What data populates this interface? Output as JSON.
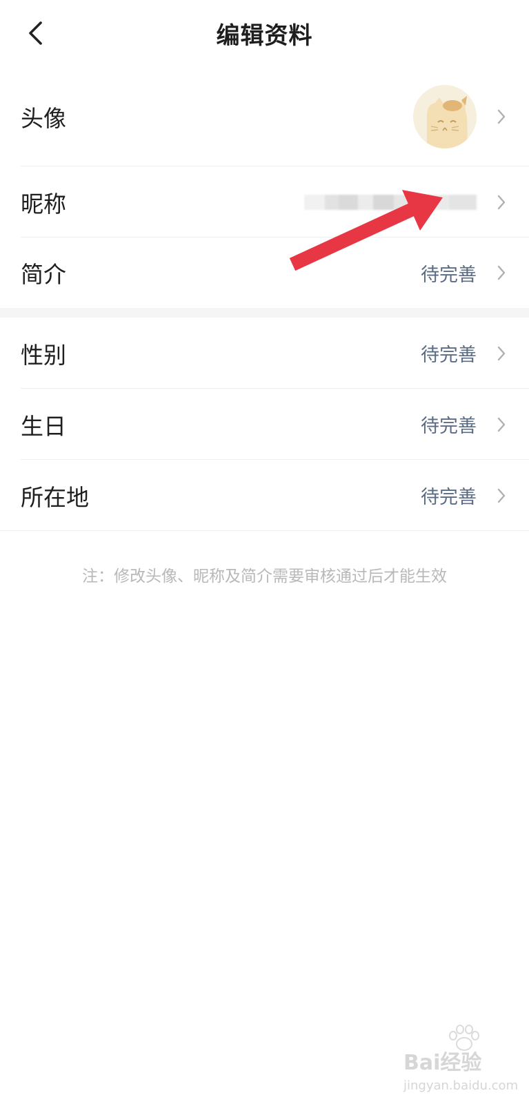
{
  "header": {
    "title": "编辑资料",
    "back_icon": "chevron-left-icon"
  },
  "rows": [
    {
      "key": "avatar",
      "label": "头像",
      "value": ""
    },
    {
      "key": "nickname",
      "label": "昵称",
      "value": ""
    },
    {
      "key": "intro",
      "label": "简介",
      "value": "待完善"
    },
    {
      "key": "gender",
      "label": "性别",
      "value": "待完善"
    },
    {
      "key": "birthday",
      "label": "生日",
      "value": "待完善"
    },
    {
      "key": "location",
      "label": "所在地",
      "value": "待完善"
    }
  ],
  "note": "注：修改头像、昵称及简介需要审核通过后才能生效",
  "watermark": {
    "main": "Bai经验",
    "sub": "jingyan.baidu.com"
  },
  "colors": {
    "value_text": "#5a6b84",
    "annotation_arrow": "#e83744",
    "chevron": "#b0b0b0"
  }
}
